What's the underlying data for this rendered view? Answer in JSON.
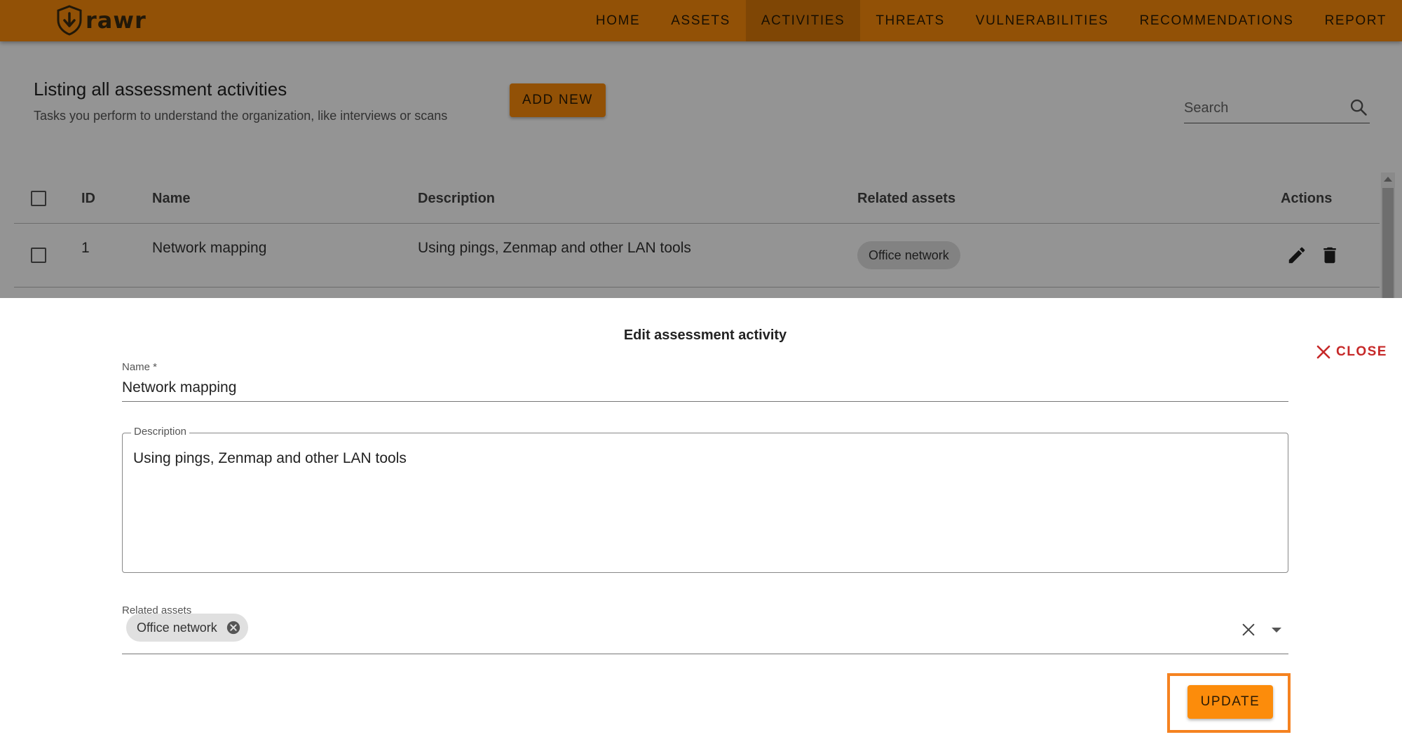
{
  "app": {
    "logo_text": "rawr",
    "accent_color": "#fc8c0b"
  },
  "nav": {
    "items": [
      {
        "label": "HOME",
        "active": false
      },
      {
        "label": "ASSETS",
        "active": false
      },
      {
        "label": "ACTIVITIES",
        "active": true
      },
      {
        "label": "THREATS",
        "active": false
      },
      {
        "label": "VULNERABILITIES",
        "active": false
      },
      {
        "label": "RECOMMENDATIONS",
        "active": false
      },
      {
        "label": "REPORT",
        "active": false
      }
    ]
  },
  "page": {
    "title": "Listing all assessment activities",
    "subtitle": "Tasks you perform to understand the organization, like interviews or scans",
    "add_button": "ADD NEW",
    "search_placeholder": "Search"
  },
  "table": {
    "columns": {
      "id": "ID",
      "name": "Name",
      "description": "Description",
      "related_assets": "Related assets",
      "actions": "Actions"
    },
    "rows": [
      {
        "id": "1",
        "name": "Network mapping",
        "description": "Using pings, Zenmap and other LAN tools",
        "related_assets": [
          "Office network"
        ]
      }
    ]
  },
  "dialog": {
    "title": "Edit assessment activity",
    "close_label": "CLOSE",
    "name_label": "Name *",
    "name_value": "Network mapping",
    "description_label": "Description",
    "description_value": "Using pings, Zenmap and other LAN tools",
    "related_assets_label": "Related assets",
    "related_assets": [
      "Office network"
    ],
    "update_button": "UPDATE"
  }
}
